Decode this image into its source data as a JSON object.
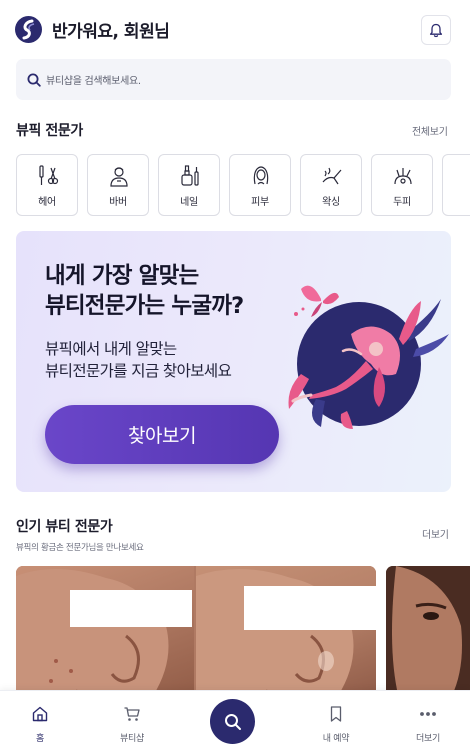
{
  "header": {
    "greeting": "반가워요, 회원님"
  },
  "search": {
    "placeholder": "뷰티샵을 검색해보세요."
  },
  "experts_section": {
    "title": "뷰픽 전문가",
    "view_all": "전체보기",
    "categories": [
      {
        "label": "헤어",
        "icon": "hair-tools-icon"
      },
      {
        "label": "바버",
        "icon": "barber-icon"
      },
      {
        "label": "네일",
        "icon": "nail-polish-icon"
      },
      {
        "label": "피부",
        "icon": "skin-face-icon"
      },
      {
        "label": "왁싱",
        "icon": "waxing-icon"
      },
      {
        "label": "두피",
        "icon": "scalp-icon"
      }
    ]
  },
  "banner": {
    "headline_line1": "내게 가장 알맞는",
    "headline_line2": "뷰티전문가는 누굴까?",
    "body_line1": "뷰픽에서 내게 알맞는",
    "body_line2": "뷰티전문가를 지금 찾아보세요",
    "cta": "찾아보기",
    "colors": {
      "cta": "#5b3bbd",
      "illustration_bg": "#2b2a6e",
      "accent_pink": "#e85a8a"
    }
  },
  "popular_section": {
    "title": "인기 뷰티 전문가",
    "subtitle": "뷰픽의 황금손 전문가님을 만나보세요",
    "more": "더보기"
  },
  "bottom_nav": {
    "items": [
      {
        "label": "홈",
        "icon": "home-icon",
        "active": true
      },
      {
        "label": "뷰티샵",
        "icon": "cart-icon",
        "active": false
      },
      {
        "label": "",
        "icon": "search-icon",
        "active": false
      },
      {
        "label": "내 예약",
        "icon": "bookmark-icon",
        "active": false
      },
      {
        "label": "더보기",
        "icon": "more-dots-icon",
        "active": false
      }
    ]
  },
  "colors": {
    "brand_navy": "#2b2a6e",
    "search_bg": "#f3f4f9"
  }
}
